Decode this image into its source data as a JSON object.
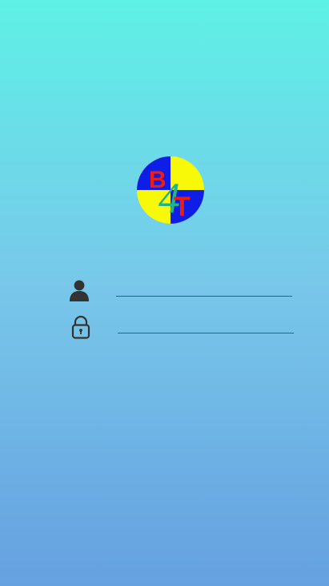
{
  "logo": {
    "letters": [
      "B",
      "4",
      "T"
    ],
    "colors": {
      "blue": "#0f1ee6",
      "yellow": "#f8f809",
      "red": "#ef1c14",
      "green": "#20b488"
    }
  },
  "login": {
    "username": {
      "icon": "person-icon",
      "value": "",
      "placeholder": ""
    },
    "password": {
      "icon": "lock-icon",
      "value": "",
      "placeholder": ""
    }
  }
}
